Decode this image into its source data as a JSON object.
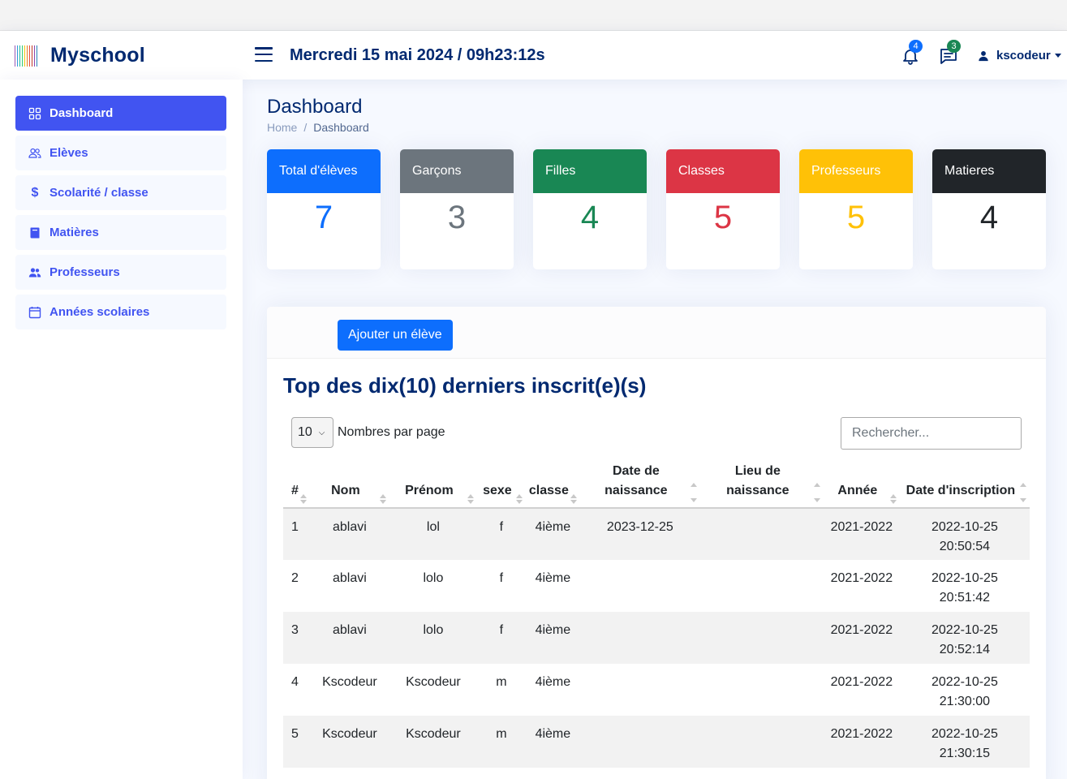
{
  "app": {
    "name": "Myschool",
    "datetime": "Mercredi 15 mai 2024 / 09h23:12s",
    "logo_colors": [
      "#9b59b6",
      "#3498db",
      "#1abc9c",
      "#2ecc71",
      "#f1c40f",
      "#e67e22",
      "#e74c3c",
      "#c0392b",
      "#8e44ad",
      "#2980b9"
    ]
  },
  "header": {
    "notifications": {
      "icon": "bell-icon",
      "count": "4",
      "color": "#0d6efd"
    },
    "messages": {
      "icon": "chat-icon",
      "count": "3",
      "color": "#198754"
    },
    "user": {
      "icon": "person-icon",
      "name": "kscodeur"
    }
  },
  "sidebar": {
    "items": [
      {
        "label": "Dashboard",
        "icon": "grid-icon",
        "active": true
      },
      {
        "label": "Elèves",
        "icon": "people-icon",
        "active": false
      },
      {
        "label": "Scolarité / classe",
        "icon": "dollar-icon",
        "active": false
      },
      {
        "label": "Matières",
        "icon": "book-icon",
        "active": false
      },
      {
        "label": "Professeurs",
        "icon": "people-fill-icon",
        "active": false
      },
      {
        "label": "Années scolaires",
        "icon": "calendar-icon",
        "active": false
      }
    ]
  },
  "page": {
    "title": "Dashboard",
    "breadcrumb": [
      "Home",
      "Dashboard"
    ]
  },
  "stats": [
    {
      "label": "Total d'élèves",
      "value": "7",
      "color": "#0d6efd"
    },
    {
      "label": "Garçons",
      "value": "3",
      "color": "#6c757d"
    },
    {
      "label": "Filles",
      "value": "4",
      "color": "#198754"
    },
    {
      "label": "Classes",
      "value": "5",
      "color": "#dc3545"
    },
    {
      "label": "Professeurs",
      "value": "5",
      "color": "#ffc107"
    },
    {
      "label": "Matieres",
      "value": "4",
      "color": "#212529"
    }
  ],
  "students": {
    "add_button": "Ajouter un élève",
    "title": "Top des dix(10) derniers inscrit(e)(s)",
    "per_page_value": "10",
    "per_page_label": "Nombres par page",
    "search_placeholder": "Rechercher...",
    "columns": [
      "#",
      "Nom",
      "Prénom",
      "sexe",
      "classe",
      "Date de naissance",
      "Lieu de naissance",
      "Année",
      "Date d'inscription"
    ],
    "rows": [
      [
        "1",
        "ablavi",
        "lol",
        "f",
        "4ième",
        "2023-12-25",
        "",
        "2021-2022",
        "2022-10-25 20:50:54"
      ],
      [
        "2",
        "ablavi",
        "lolo",
        "f",
        "4ième",
        "",
        "",
        "2021-2022",
        "2022-10-25 20:51:42"
      ],
      [
        "3",
        "ablavi",
        "lolo",
        "f",
        "4ième",
        "",
        "",
        "2021-2022",
        "2022-10-25 20:52:14"
      ],
      [
        "4",
        "Kscodeur",
        "Kscodeur",
        "m",
        "4ième",
        "",
        "",
        "2021-2022",
        "2022-10-25 21:30:00"
      ],
      [
        "5",
        "Kscodeur",
        "Kscodeur",
        "m",
        "4ième",
        "",
        "",
        "2021-2022",
        "2022-10-25 21:30:15"
      ]
    ]
  }
}
